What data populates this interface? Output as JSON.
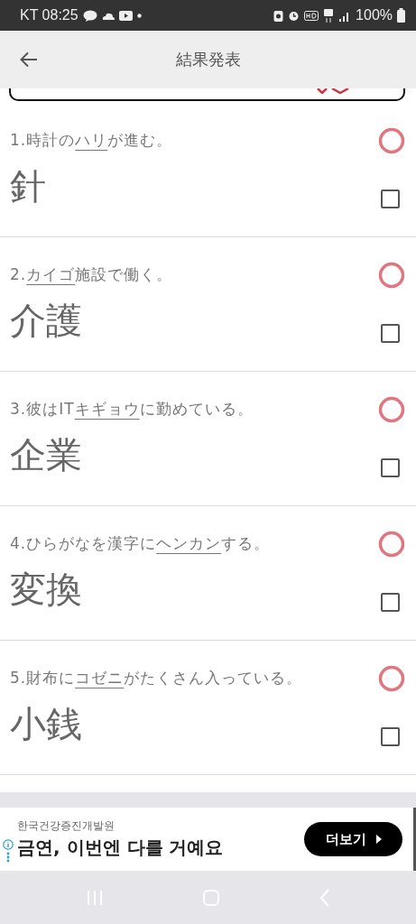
{
  "status_bar": {
    "carrier_time": "KT 08:25",
    "battery": "100%"
  },
  "app_bar": {
    "title": "結果発表"
  },
  "questions": [
    {
      "before": "1.時計の",
      "underlined": "ハリ",
      "after": "が進む。",
      "answer": "針",
      "correct": true,
      "checked": false
    },
    {
      "before": "2.",
      "underlined": "カイゴ",
      "after": "施設で働く。",
      "answer": "介護",
      "correct": true,
      "checked": false
    },
    {
      "before": "3.彼はIT",
      "underlined": "キギョウ",
      "after": "に勤めている。",
      "answer": "企業",
      "correct": true,
      "checked": false
    },
    {
      "before": "4.ひらがなを漢字に",
      "underlined": "ヘンカン",
      "after": "する。",
      "answer": "変換",
      "correct": true,
      "checked": false
    },
    {
      "before": "5.財布に",
      "underlined": "コゼニ",
      "after": "がたくさん入っている。",
      "answer": "小銭",
      "correct": true,
      "checked": false
    }
  ],
  "ad": {
    "advertiser": "한국건강증진개발원",
    "headline": "금연, 이번엔 다를 거예요",
    "button": "더보기"
  }
}
